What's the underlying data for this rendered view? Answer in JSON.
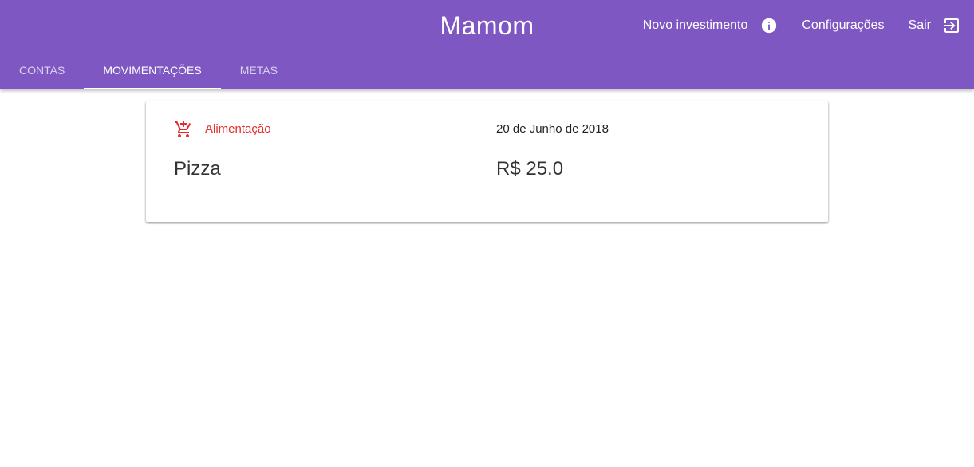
{
  "app": {
    "title": "Mamom",
    "brand_color": "#7e57c2"
  },
  "header": {
    "actions": {
      "new_investment": "Novo investimento",
      "info_icon": "info-icon",
      "settings": "Configurações",
      "logout": "Sair",
      "logout_icon": "exit-icon"
    }
  },
  "tabs": [
    {
      "label": "CONTAS",
      "active": false
    },
    {
      "label": "MOVIMENTAÇÕES",
      "active": true
    },
    {
      "label": "METAS",
      "active": false
    }
  ],
  "movements": [
    {
      "category": "Alimentação",
      "category_icon": "add-shopping-cart-icon",
      "category_color": "#e52b2b",
      "date": "20 de Junho de 2018",
      "description": "Pizza",
      "amount": "R$ 25.0"
    }
  ]
}
